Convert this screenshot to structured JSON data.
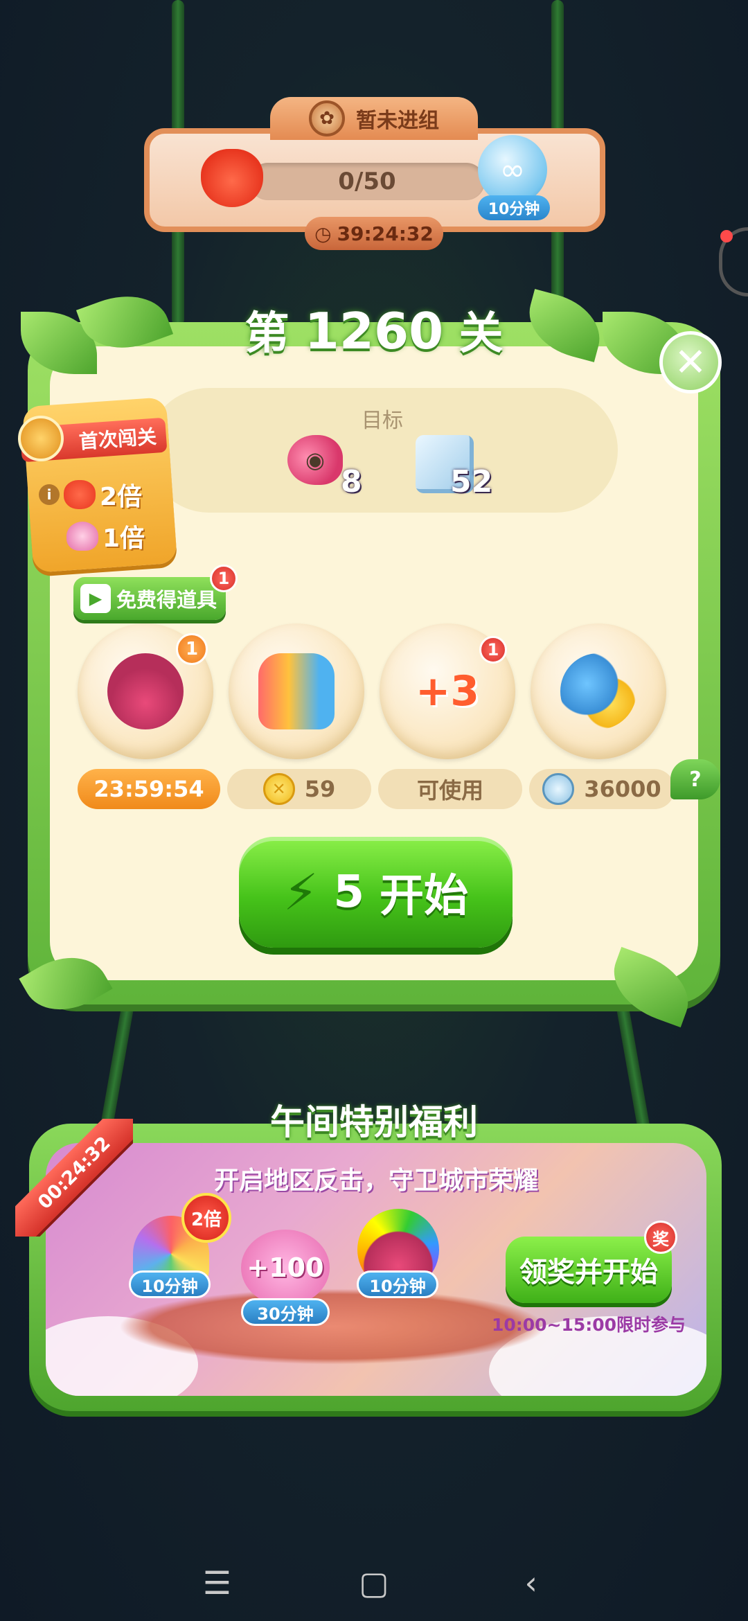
{
  "team": {
    "status": "暂未进组",
    "progress": "0/50",
    "progress_fraction": 0,
    "bottle_duration": "10分钟",
    "countdown": "39:24:32"
  },
  "level": {
    "prefix": "第",
    "number": "1260",
    "suffix": "关",
    "goal_label": "目标",
    "goals": [
      {
        "icon": "snail-icon",
        "count": "8"
      },
      {
        "icon": "ice-block-icon",
        "count": "52"
      }
    ]
  },
  "first_pass": {
    "label": "首次闯关",
    "fox_multiplier": "2倍",
    "lotus_multiplier": "1倍"
  },
  "free_items": {
    "label": "免费得道具",
    "badge": "1"
  },
  "boosters": [
    {
      "icon": "rainbow-owl-icon",
      "badge": "1",
      "status": "23:59:54"
    },
    {
      "icon": "rocket-icon",
      "badge": "",
      "status": "59"
    },
    {
      "icon": "plus-three-moves-icon",
      "glyph": "+3",
      "badge": "1",
      "status": "可使用"
    },
    {
      "icon": "pet-pair-icon",
      "badge": "",
      "status": "36000"
    }
  ],
  "help": "?",
  "start": {
    "energy": "5",
    "label": "开始"
  },
  "bonus": {
    "title": "午间特别福利",
    "subtitle": "开启地区反击，守卫城市荣耀",
    "timer": "00:24:32",
    "multiplier": "2倍",
    "rewards": [
      {
        "icon": "rainbow-leaf-icon",
        "tag": "10分钟"
      },
      {
        "icon": "plus-100-icon",
        "text": "+100",
        "tag": "30分钟"
      },
      {
        "icon": "rainbow-owl-icon",
        "tag": "10分钟"
      }
    ],
    "claim_label": "领奖并开始",
    "claim_badge": "奖",
    "time_note": "10:00~15:00限时参与"
  },
  "colors": {
    "green_button": "#46c31a",
    "orange": "#f08a1a",
    "panel_cream": "#fdf5d9"
  }
}
